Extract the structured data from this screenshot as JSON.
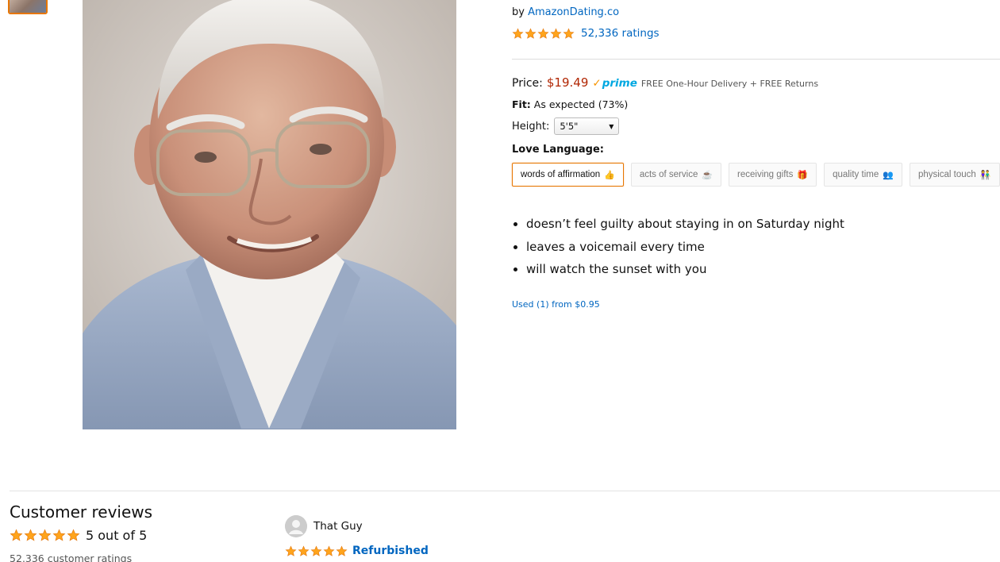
{
  "product": {
    "byline_prefix": "by",
    "seller": "AmazonDating.co",
    "ratings_count_label": "52,336 ratings",
    "rating_stars": 5,
    "price_label": "Price:",
    "price_value": "$19.49",
    "prime_label": "prime",
    "delivery_note": "FREE One-Hour Delivery + FREE Returns",
    "fit_label": "Fit:",
    "fit_value": "As expected (73%)",
    "height_label": "Height:",
    "height_selected": "5'5\"",
    "love_language_label": "Love Language:",
    "love_languages": [
      {
        "label": "words of affirmation",
        "emoji": "👍",
        "selected": true
      },
      {
        "label": "acts of service",
        "emoji": "☕",
        "selected": false
      },
      {
        "label": "receiving gifts",
        "emoji": "🎁",
        "selected": false
      },
      {
        "label": "quality time",
        "emoji": "👥",
        "selected": false
      },
      {
        "label": "physical touch",
        "emoji": "👫",
        "selected": false
      }
    ],
    "bullets": [
      "doesn’t feel guilty about staying in on Saturday night",
      "leaves a voicemail every time",
      "will watch the sunset with you"
    ],
    "used_offer": "Used (1) from $0.95"
  },
  "reviews": {
    "heading": "Customer reviews",
    "overall_stars": 5,
    "overall_label": "5 out of 5",
    "total_ratings": "52,336 customer ratings",
    "first_review": {
      "user": "That Guy",
      "stars": 5,
      "title": "Refurbished"
    }
  },
  "colors": {
    "link": "#0066c0",
    "price": "#b12704",
    "star": "#ffa41c",
    "selected_border": "#e77600",
    "prime": "#00a8e1"
  },
  "icons": {
    "star": "star-icon",
    "avatar": "user-avatar-icon",
    "dropdown": "caret-down-icon"
  }
}
